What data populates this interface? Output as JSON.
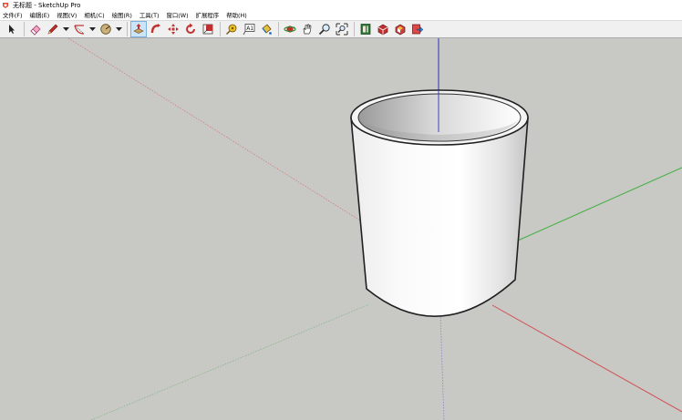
{
  "window": {
    "title": "无标题 - SketchUp Pro",
    "logo_icon": "sketchup-logo-icon",
    "logo_color": "#e34a33"
  },
  "menu": {
    "items": [
      {
        "label": "文件(F)"
      },
      {
        "label": "编辑(E)"
      },
      {
        "label": "视图(V)"
      },
      {
        "label": "相机(C)"
      },
      {
        "label": "绘图(R)"
      },
      {
        "label": "工具(T)"
      },
      {
        "label": "窗口(W)"
      },
      {
        "label": "扩展程序"
      },
      {
        "label": "帮助(H)"
      }
    ]
  },
  "toolbar": {
    "tools": [
      "select-icon",
      "eraser-icon",
      "line-pencil-icon",
      "arc-icon",
      "shapes-icon",
      "push-pull-icon",
      "follow-me-icon",
      "move-icon",
      "rotate-icon",
      "scale-icon",
      "tape-measure-icon",
      "text-icon",
      "paint-bucket-icon",
      "orbit-icon",
      "pan-icon",
      "zoom-icon",
      "zoom-extents-icon",
      "3d-warehouse-icon",
      "extension-warehouse-icon",
      "layout-icon",
      "send-to-layout-icon"
    ],
    "selected_tool": "push-pull-icon"
  },
  "viewport": {
    "background": "#c8c8c4",
    "axes": {
      "red": "#d05050",
      "green": "#40b040",
      "blue": "#3030c0"
    },
    "model": "hollow-cylinder"
  }
}
